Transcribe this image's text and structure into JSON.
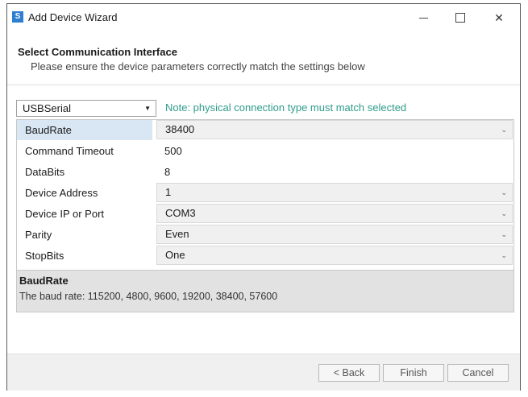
{
  "window": {
    "title": "Add Device Wizard",
    "icon": "app-logo-icon",
    "controls": {
      "minimize": "minimize-icon",
      "maximize": "maximize-icon",
      "close_glyph": "✕"
    }
  },
  "header": {
    "title": "Select Communication Interface",
    "subtitle": "Please ensure the device parameters correctly match the settings below"
  },
  "interface": {
    "selected": "USBSerial",
    "note": "Note: physical connection type must match selected"
  },
  "properties": [
    {
      "name": "BaudRate",
      "value": "38400",
      "dropdown": true,
      "selected": true
    },
    {
      "name": "Command Timeout",
      "value": "500",
      "dropdown": false
    },
    {
      "name": "DataBits",
      "value": "8",
      "dropdown": false
    },
    {
      "name": "Device Address",
      "value": "1",
      "dropdown": true
    },
    {
      "name": "Device IP or Port",
      "value": "COM3",
      "dropdown": true
    },
    {
      "name": "Parity",
      "value": "Even",
      "dropdown": true
    },
    {
      "name": "StopBits",
      "value": "One",
      "dropdown": true
    }
  ],
  "description": {
    "title": "BaudRate",
    "text": "The baud rate: 115200, 4800, 9600, 19200, 38400, 57600"
  },
  "footer": {
    "back": "< Back",
    "finish": "Finish",
    "cancel": "Cancel"
  },
  "colors": {
    "note": "#2e9c8a",
    "selected_row": "#d9e6f3",
    "app_icon": "#2f7fd1"
  }
}
